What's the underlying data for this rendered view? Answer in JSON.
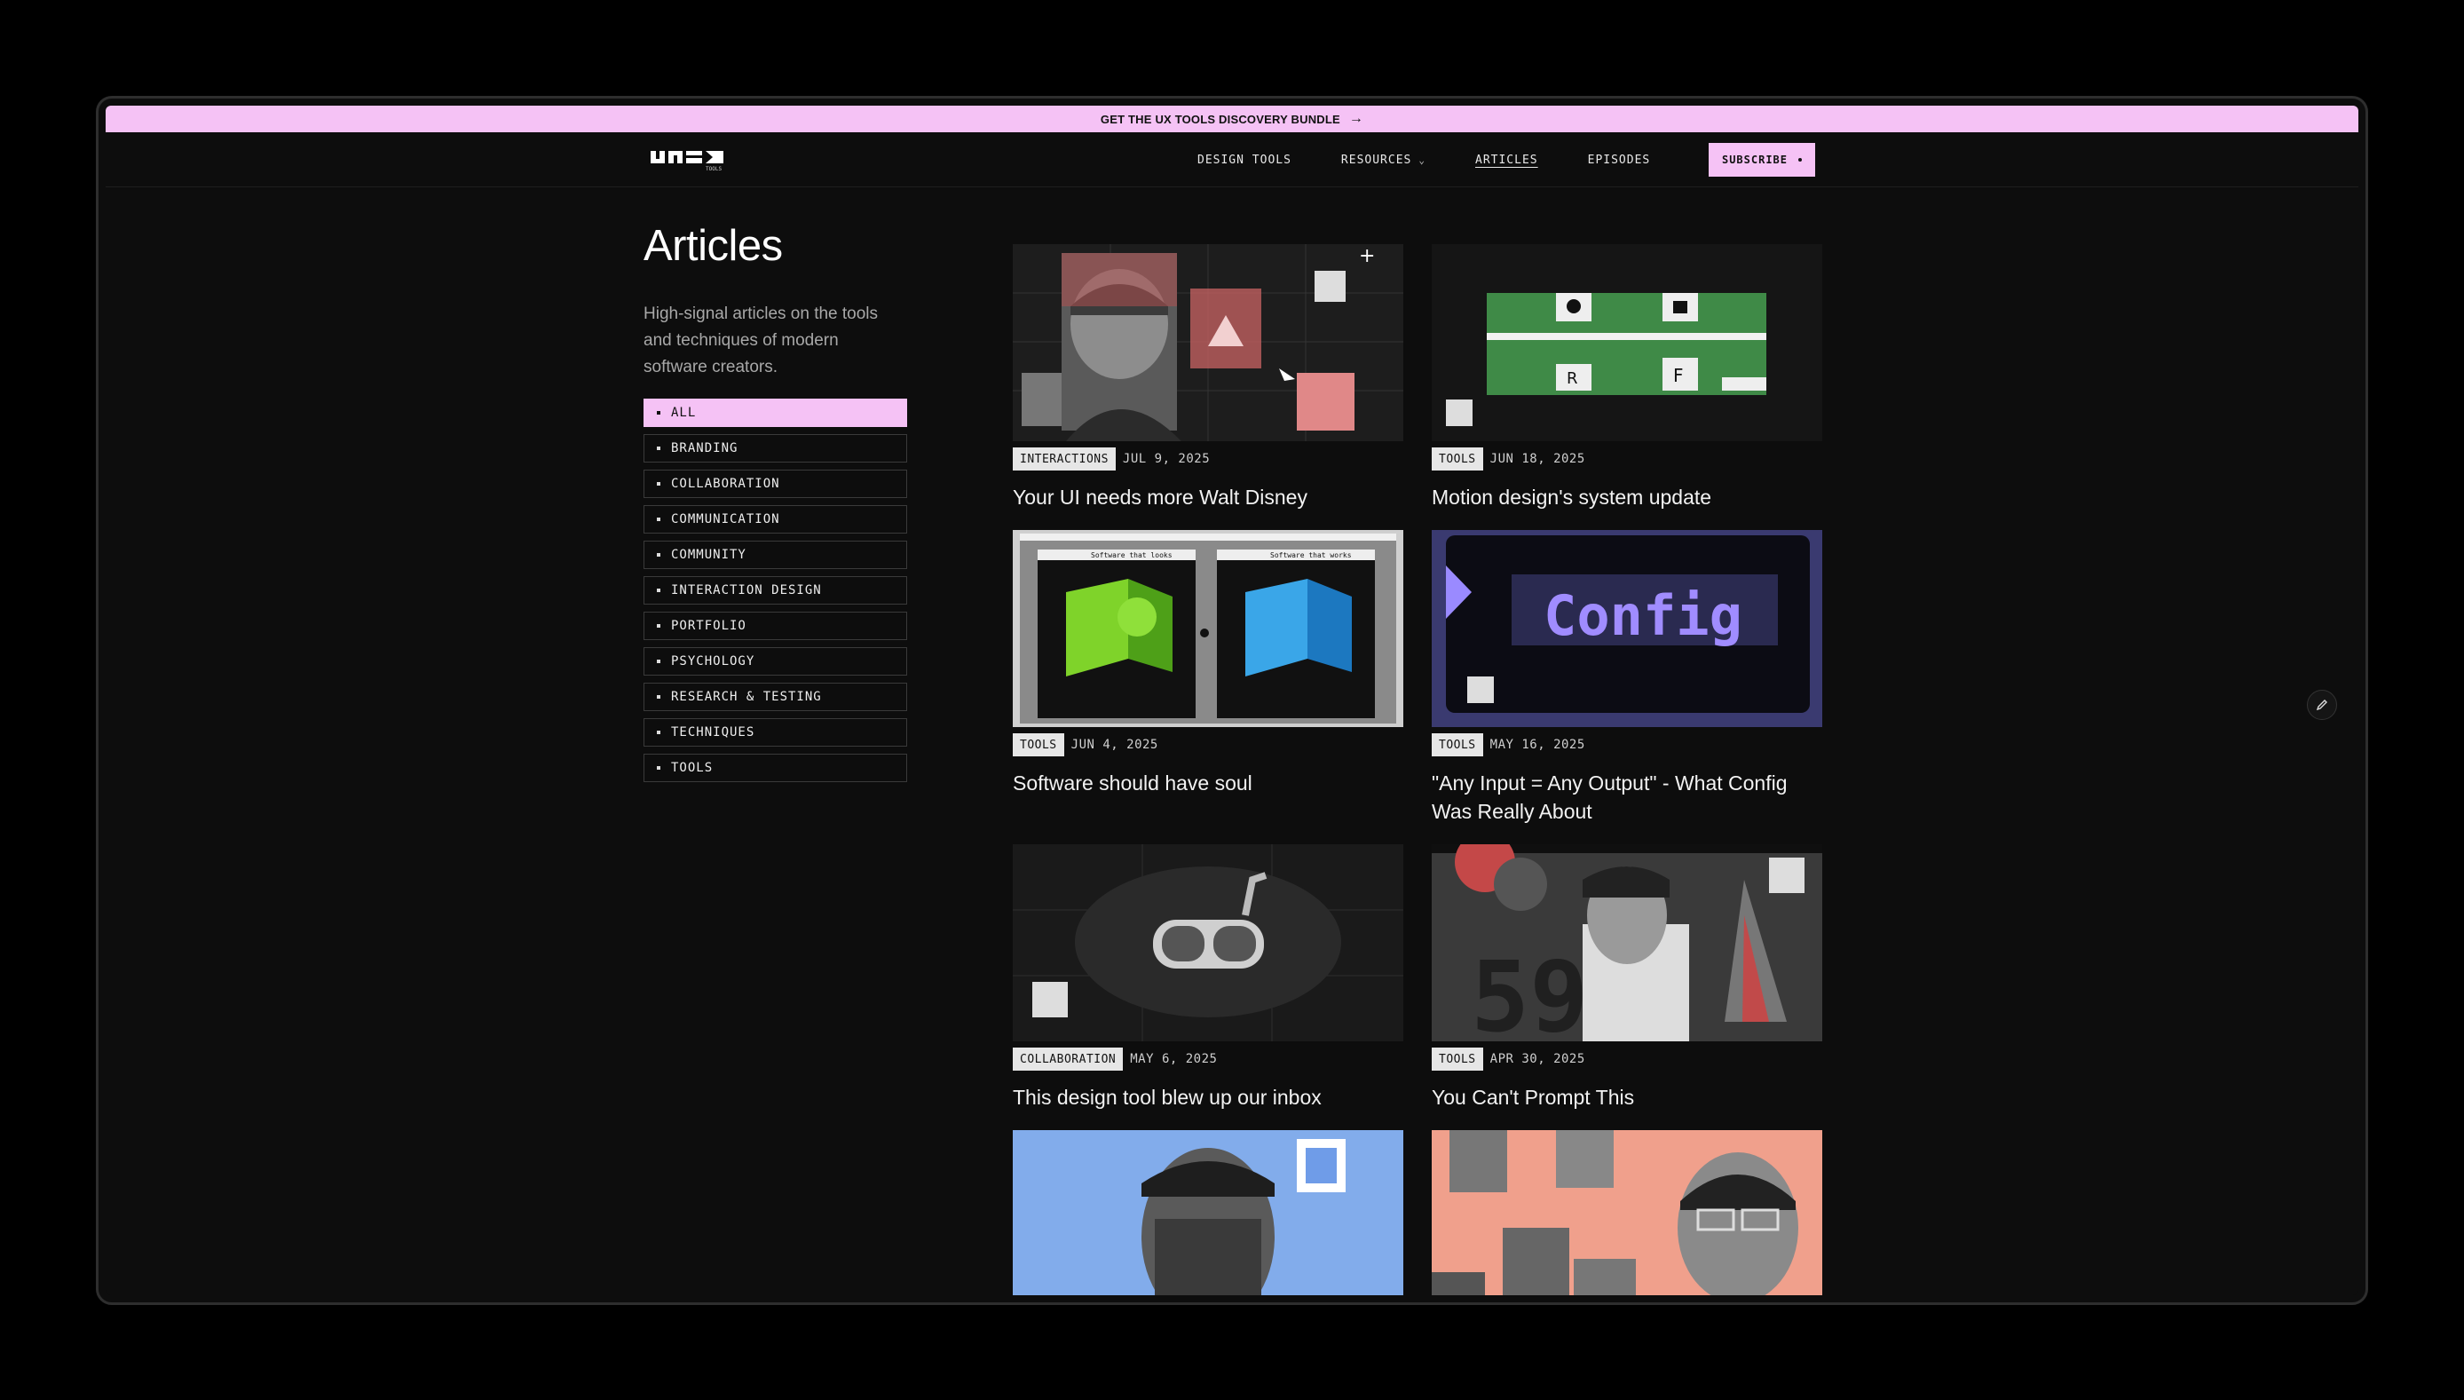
{
  "promo": {
    "label": "GET THE UX TOOLS DISCOVERY BUNDLE"
  },
  "nav": {
    "logo_sub": "TOOLS",
    "links": [
      {
        "label": "DESIGN TOOLS"
      },
      {
        "label": "RESOURCES"
      },
      {
        "label": "ARTICLES"
      },
      {
        "label": "EPISODES"
      }
    ],
    "subscribe_label": "SUBSCRIBE"
  },
  "sidebar": {
    "title": "Articles",
    "description": "High-signal articles on the tools and techniques of modern software creators.",
    "filters": [
      "ALL",
      "BRANDING",
      "COLLABORATION",
      "COMMUNICATION",
      "COMMUNITY",
      "INTERACTION DESIGN",
      "PORTFOLIO",
      "PSYCHOLOGY",
      "RESEARCH & TESTING",
      "TECHNIQUES",
      "TOOLS"
    ],
    "active_filter": "ALL"
  },
  "articles": [
    {
      "tag": "INTERACTIONS",
      "date": "JUL 9, 2025",
      "title": "Your UI needs more Walt Disney"
    },
    {
      "tag": "TOOLS",
      "date": "JUN 18, 2025",
      "title": "Motion design's system update"
    },
    {
      "tag": "TOOLS",
      "date": "JUN 4, 2025",
      "title": "Software should have soul",
      "img_left": "Software that looks",
      "img_right": "Software that works"
    },
    {
      "tag": "TOOLS",
      "date": "MAY 16, 2025",
      "title": "\"Any Input = Any Output\" - What Config Was Really About",
      "img_text": "Config"
    },
    {
      "tag": "COLLABORATION",
      "date": "MAY 6, 2025",
      "title": "This design tool blew up our inbox"
    },
    {
      "tag": "TOOLS",
      "date": "APR 30, 2025",
      "title": "You Can't Prompt This",
      "img_text": "59"
    },
    {
      "tag": "",
      "date": "",
      "title": ""
    },
    {
      "tag": "",
      "date": "",
      "title": ""
    }
  ],
  "colors": {
    "accent": "#f5c2f5",
    "background": "#0d0d0d",
    "tag_bg": "#e6e6e6"
  },
  "icons": {
    "edit": "pencil-icon",
    "arrow": "arrow-right-icon",
    "chevron": "chevron-down-icon"
  }
}
